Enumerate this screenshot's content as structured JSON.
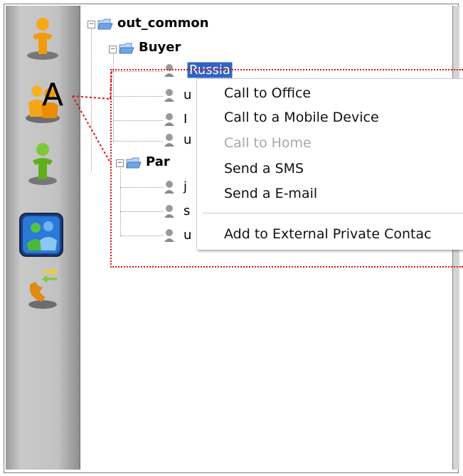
{
  "tree": {
    "root": {
      "label": "out_common",
      "expander": "⊟"
    },
    "groups": [
      {
        "label": "Buyer",
        "expander": "⊟",
        "children": [
          {
            "label": "Russia"
          },
          {
            "label": "u"
          },
          {
            "label": "I"
          },
          {
            "label": "u"
          }
        ]
      },
      {
        "label": "Par",
        "expander": "⊟",
        "children": [
          {
            "label": "j"
          },
          {
            "label": "s"
          },
          {
            "label": "u"
          }
        ]
      }
    ]
  },
  "context_menu": {
    "items": [
      {
        "label": "Call to Office",
        "enabled": true
      },
      {
        "label": "Call to a Mobile Device",
        "enabled": true
      },
      {
        "label": "Call to Home",
        "enabled": false
      },
      {
        "label": "Send a SMS",
        "enabled": true
      },
      {
        "label": "Send a E-mail",
        "enabled": true
      },
      {
        "label": "Add to External Private Contac",
        "enabled": true
      }
    ]
  },
  "annotation": {
    "label": "A",
    "color": "#e01010"
  },
  "sidebar": {
    "buttons": [
      {
        "icon": "orange-person-icon"
      },
      {
        "icon": "group-contacts-icon"
      },
      {
        "icon": "green-person-icon"
      },
      {
        "icon": "external-contacts-icon",
        "selected": true
      },
      {
        "icon": "call-transfer-icon"
      }
    ]
  }
}
